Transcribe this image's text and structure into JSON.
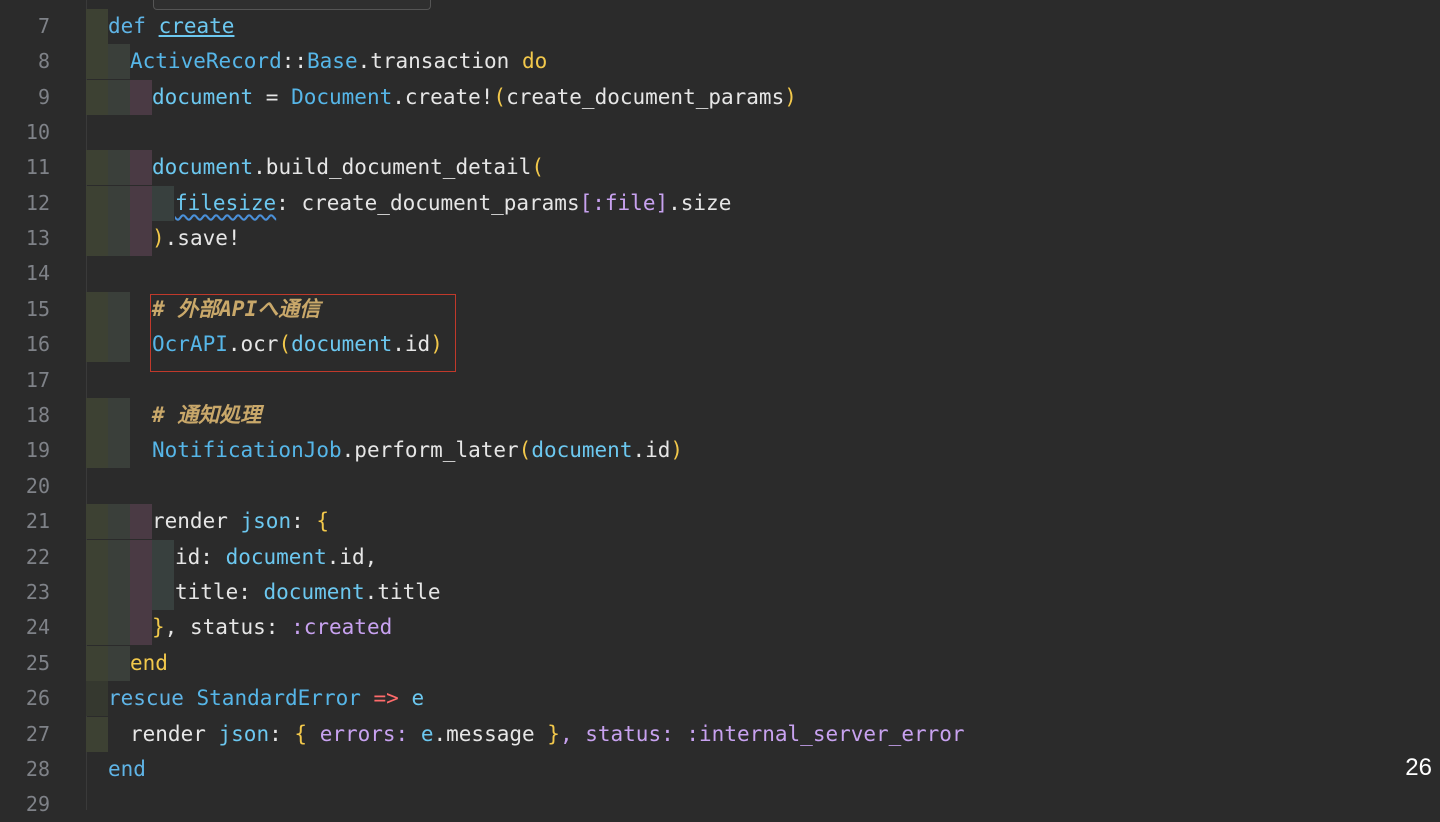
{
  "editor": {
    "lines": [
      {
        "num": "7"
      },
      {
        "num": "8"
      },
      {
        "num": "9"
      },
      {
        "num": "10"
      },
      {
        "num": "11"
      },
      {
        "num": "12"
      },
      {
        "num": "13"
      },
      {
        "num": "14"
      },
      {
        "num": "15"
      },
      {
        "num": "16"
      },
      {
        "num": "17"
      },
      {
        "num": "18"
      },
      {
        "num": "19"
      },
      {
        "num": "20"
      },
      {
        "num": "21"
      },
      {
        "num": "22"
      },
      {
        "num": "23"
      },
      {
        "num": "24"
      },
      {
        "num": "25"
      },
      {
        "num": "26"
      },
      {
        "num": "27"
      },
      {
        "num": "28"
      },
      {
        "num": "29"
      }
    ],
    "tokens": {
      "l7_def": "def",
      "l7_create": "create",
      "l8_ar": "ActiveRecord",
      "l8_sep": "::",
      "l8_base": "Base",
      "l8_tx": ".transaction ",
      "l8_do": "do",
      "l9_doc": "document",
      "l9_eq": " = ",
      "l9_Doc": "Document",
      "l9_create": ".create!",
      "l9_lp": "(",
      "l9_params": "create_document_params",
      "l9_rp": ")",
      "l11_doc": "document",
      "l11_call": ".build_document_detail",
      "l11_lp": "(",
      "l12_filesize": "filesize",
      "l12_colon": ": create_document_params",
      "l12_lb": "[",
      "l12_sym": ":file",
      "l12_rb": "]",
      "l12_size": ".size",
      "l13_rp": ")",
      "l13_save": ".save!",
      "l15_comment": "# 外部APIへ通信",
      "l16_ocr": "OcrAPI",
      "l16_call": ".ocr",
      "l16_lp": "(",
      "l16_doc": "document",
      "l16_id": ".id",
      "l16_rp": ")",
      "l18_comment": "# 通知処理",
      "l19_job": "NotificationJob",
      "l19_call": ".perform_later",
      "l19_lp": "(",
      "l19_doc": "document",
      "l19_id": ".id",
      "l19_rp": ")",
      "l21_render": "render ",
      "l21_json": "json",
      "l21_colon": ": ",
      "l21_lb": "{",
      "l22_id": "id",
      "l22_colon": ": ",
      "l22_doc": "document",
      "l22_rest": ".id,",
      "l23_title": "title",
      "l23_colon": ": ",
      "l23_doc": "document",
      "l23_rest": ".title",
      "l24_rb": "}",
      "l24_status": ", status: ",
      "l24_sym": ":created",
      "l25_end": "end",
      "l26_rescue": "rescue ",
      "l26_err": "StandardError",
      "l26_arrow": " => ",
      "l26_e": "e",
      "l27_render": "render ",
      "l27_json": "json",
      "l27_colon": ": ",
      "l27_lb": "{",
      "l27_errors": " errors: ",
      "l27_e": "e",
      "l27_msg": ".message ",
      "l27_rb": "}",
      "l27_status": ", status: ",
      "l27_sym": ":internal_server_error",
      "l28_end": "end"
    }
  },
  "slide": {
    "page_number": "26"
  },
  "colors": {
    "background": "#2b2b2b",
    "highlight_border": "#c0392b",
    "comment": "#c9a86a"
  }
}
